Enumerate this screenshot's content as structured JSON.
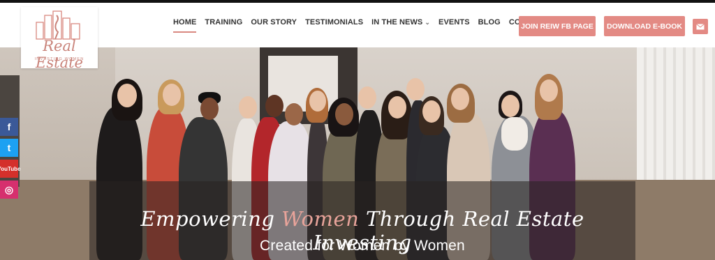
{
  "brand": {
    "logo_script": "Real Estate",
    "logo_sub": "INVESTING WOMEN",
    "accent": "#e38a84"
  },
  "nav": {
    "items": [
      {
        "label": "HOME",
        "active": true
      },
      {
        "label": "TRAINING"
      },
      {
        "label": "OUR STORY"
      },
      {
        "label": "TESTIMONIALS"
      },
      {
        "label": "IN THE NEWS",
        "has_dropdown": true
      },
      {
        "label": "EVENTS"
      },
      {
        "label": "BLOG"
      },
      {
        "label": "CONTACT US"
      }
    ]
  },
  "buttons": {
    "join": "JOIN REIW FB PAGE",
    "ebook": "DOWNLOAD E-BOOK",
    "mail_icon": "envelope-icon"
  },
  "hero": {
    "tagline_part1": "Empowering ",
    "tagline_highlight": "Women",
    "tagline_part2": " Through Real Estate Investing",
    "subtagline": "Created for Women by Women"
  },
  "social": {
    "facebook": "f",
    "twitter": "t",
    "youtube": "YouTube",
    "instagram": "◎"
  }
}
